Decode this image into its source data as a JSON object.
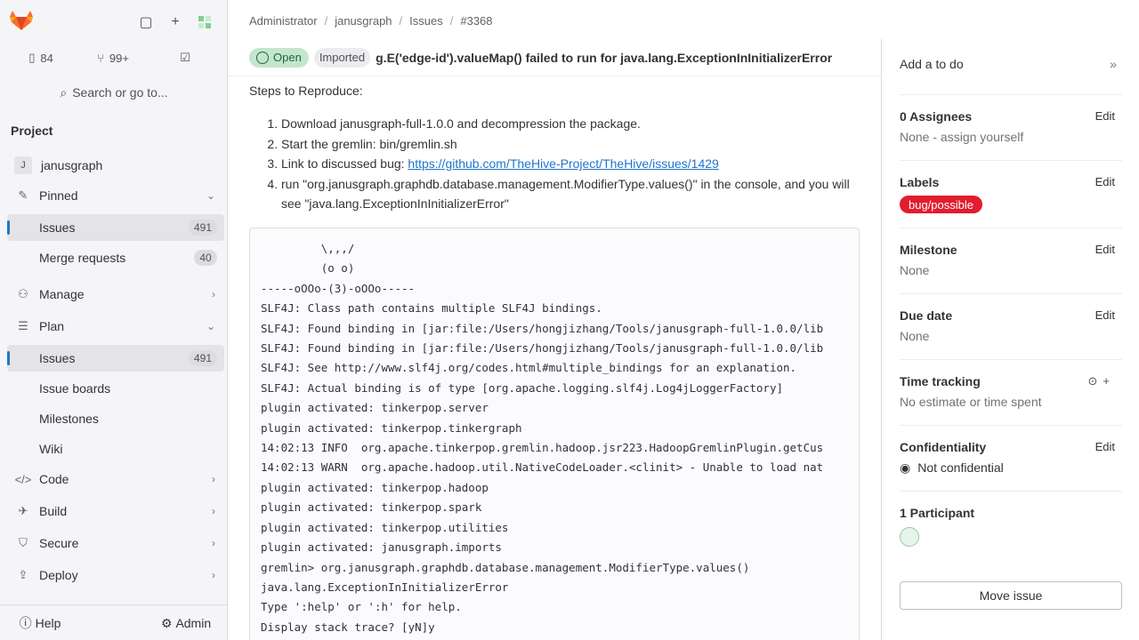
{
  "sidebar": {
    "counts": {
      "issues": "84",
      "merge_requests": "99+"
    },
    "search_label": "Search or go to...",
    "section_title": "Project",
    "project": {
      "initial": "J",
      "name": "janusgraph"
    },
    "items": [
      {
        "label": "Pinned"
      },
      {
        "label": "Issues",
        "badge": "491"
      },
      {
        "label": "Merge requests",
        "badge": "40"
      },
      {
        "label": "Manage"
      },
      {
        "label": "Plan"
      },
      {
        "label": "Issues",
        "badge": "491"
      },
      {
        "label": "Issue boards"
      },
      {
        "label": "Milestones"
      },
      {
        "label": "Wiki"
      },
      {
        "label": "Code"
      },
      {
        "label": "Build"
      },
      {
        "label": "Secure"
      },
      {
        "label": "Deploy"
      }
    ],
    "help_label": "Help",
    "admin_label": "Admin"
  },
  "breadcrumb": [
    "Administrator",
    "janusgraph",
    "Issues",
    "#3368"
  ],
  "issue": {
    "status": "Open",
    "imported": "Imported",
    "title": "g.E('edge-id').valueMap() failed to run for java.lang.ExceptionInInitializerError",
    "steps_heading": "Steps to Reproduce:",
    "steps": [
      "Download janusgraph-full-1.0.0 and decompression the package.",
      "Start the gremlin: bin/gremlin.sh",
      "Link to discussed bug: ",
      "run \"org.janusgraph.graphdb.database.management.ModifierType.values()\" in the console, and you will see \"java.lang.ExceptionInInitializerError\""
    ],
    "bug_link": "https://github.com/TheHive-Project/TheHive/issues/1429",
    "code": "         \\,,,/\n         (o o)\n-----oOOo-(3)-oOOo-----\nSLF4J: Class path contains multiple SLF4J bindings.\nSLF4J: Found binding in [jar:file:/Users/hongjizhang/Tools/janusgraph-full-1.0.0/lib\nSLF4J: Found binding in [jar:file:/Users/hongjizhang/Tools/janusgraph-full-1.0.0/lib\nSLF4J: See http://www.slf4j.org/codes.html#multiple_bindings for an explanation.\nSLF4J: Actual binding is of type [org.apache.logging.slf4j.Log4jLoggerFactory]\nplugin activated: tinkerpop.server\nplugin activated: tinkerpop.tinkergraph\n14:02:13 INFO  org.apache.tinkerpop.gremlin.hadoop.jsr223.HadoopGremlinPlugin.getCus\n14:02:13 WARN  org.apache.hadoop.util.NativeCodeLoader.<clinit> - Unable to load nat\nplugin activated: tinkerpop.hadoop\nplugin activated: tinkerpop.spark\nplugin activated: tinkerpop.utilities\nplugin activated: janusgraph.imports\ngremlin> org.janusgraph.graphdb.database.management.ModifierType.values()\njava.lang.ExceptionInInitializerError\nType ':help' or ':h' for help.\nDisplay stack trace? [yN]y"
  },
  "right": {
    "todo": "Add a to do",
    "assignees_title": "0 Assignees",
    "assignees_value": "None - ",
    "assign_self": "assign yourself",
    "labels_title": "Labels",
    "label": "bug/possible",
    "milestone_title": "Milestone",
    "milestone_value": "None",
    "due_title": "Due date",
    "due_value": "None",
    "time_title": "Time tracking",
    "time_value": "No estimate or time spent",
    "conf_title": "Confidentiality",
    "conf_value": "Not confidential",
    "participants_title": "1 Participant",
    "edit": "Edit",
    "move": "Move issue"
  },
  "colors": {
    "accent": "#1f75cb",
    "open_bg": "#c3e6cd",
    "label": "#e11d2e"
  }
}
